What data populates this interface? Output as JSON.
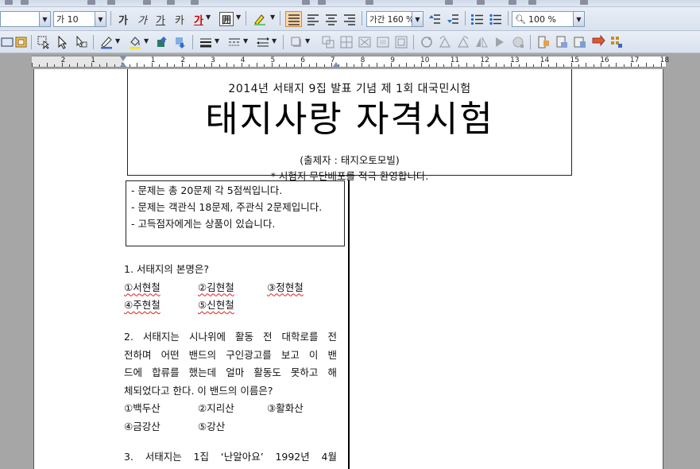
{
  "toolbar": {
    "style_combo_value": "",
    "font_size_value": "가 10",
    "format_buttons": [
      "가",
      "가",
      "가",
      "카",
      "가"
    ],
    "border_button_label": "囲",
    "line_spacing_value": "가간 160 %",
    "zoom_value": "100 %"
  },
  "ruler": {
    "numbers": [
      "2",
      "1",
      "1",
      "2",
      "3",
      "4",
      "5",
      "6",
      "7",
      "8",
      "9",
      "10",
      "11",
      "12",
      "13",
      "14",
      "15",
      "16",
      "17",
      "18"
    ]
  },
  "document": {
    "header": {
      "subtitle": "2014년 서태지 9집 발표 기념 제 1회 대국민시험",
      "title": "태지사랑 자격시험",
      "author": "(출제자 : 태지오토모빌)",
      "note": "* 시험지 무단배포를 적극 환영합니다."
    },
    "rules": [
      "- 문제는 총 20문제 각 5점씩입니다.",
      "- 문제는 객관식 18문제, 주관식 2문제입니다.",
      "- 고득점자에게는 상품이 있습니다."
    ],
    "q1": {
      "text": "1. 서태지의 본명은?",
      "options": [
        "①서현철",
        "②김현철",
        "③정현철",
        "④주현철",
        "⑤신현철"
      ]
    },
    "q2": {
      "lines": [
        "2. 서태지는 시나위에 활동 전 대학로를 전",
        "전하며 어떤 밴드의 구인광고를 보고 이 밴",
        "드에 합류를 했는데 얼마 활동도 못하고 해",
        "체되었다고 한다. 이 밴드의 이름은?"
      ],
      "options": [
        "①백두산",
        "②지리산",
        "③활화산",
        "④금강산",
        "⑤강산"
      ]
    },
    "q3": {
      "text": "3. 서태지는 1집 ‘난알아요’ 1992년 4월"
    }
  }
}
